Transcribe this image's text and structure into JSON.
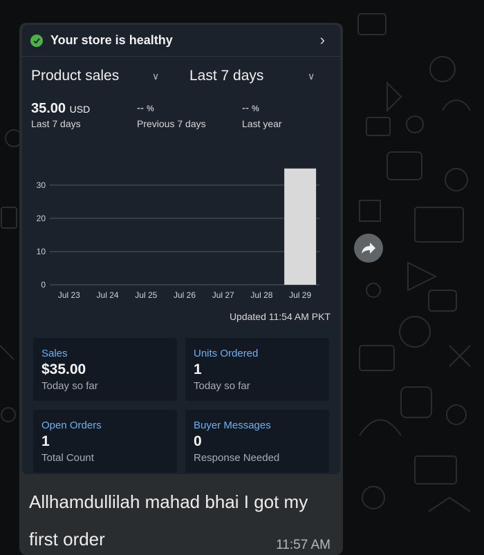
{
  "store_health": {
    "text": "Your store is healthy",
    "icon": "check-circle-icon",
    "chevron_icon": "chevron-right-icon",
    "color": "#4fb04a"
  },
  "selectors": {
    "metric": "Product sales",
    "period": "Last 7 days"
  },
  "metrics": {
    "current": {
      "value": "35.00",
      "unit": "USD",
      "label": "Last 7 days"
    },
    "previous": {
      "value": "--",
      "unit": "%",
      "label": "Previous 7 days"
    },
    "last_year": {
      "value": "--",
      "unit": "%",
      "label": "Last year"
    }
  },
  "chart_data": {
    "type": "bar",
    "categories": [
      "Jul 23",
      "Jul 24",
      "Jul 25",
      "Jul 26",
      "Jul 27",
      "Jul 28",
      "Jul 29"
    ],
    "values": [
      0,
      0,
      0,
      0,
      0,
      0,
      35
    ],
    "y_ticks": [
      0,
      10,
      20,
      30
    ],
    "ylim": [
      0,
      36
    ],
    "grid": true,
    "bar_color": "#d9d9d9"
  },
  "updated": "Updated 11:54 AM PKT",
  "tiles": [
    {
      "title": "Sales",
      "value": "$35.00",
      "sub": "Today so far"
    },
    {
      "title": "Units Ordered",
      "value": "1",
      "sub": "Today so far"
    },
    {
      "title": "Open Orders",
      "value": "1",
      "sub": "Total Count"
    },
    {
      "title": "Buyer Messages",
      "value": "0",
      "sub": "Response Needed"
    }
  ],
  "message": {
    "text": "Allhamdullilah mahad bhai I got my first order",
    "time": "11:57 AM"
  },
  "forward_icon": "forward-arrow-icon"
}
